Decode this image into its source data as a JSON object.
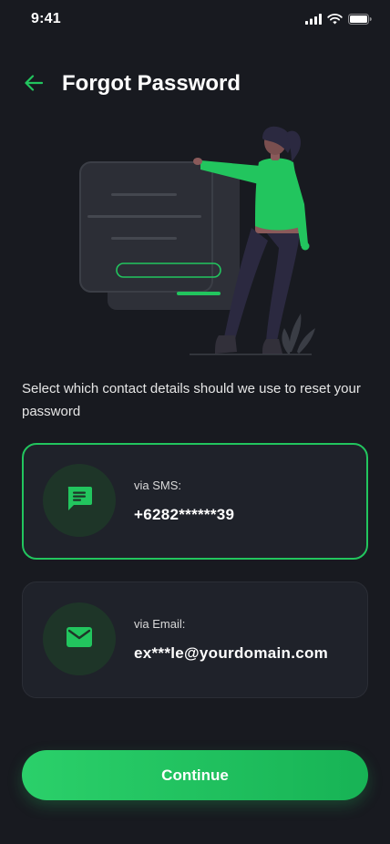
{
  "status_bar": {
    "time": "9:41"
  },
  "header": {
    "title": "Forgot Password"
  },
  "instruction": "Select which contact details should we use to reset your password",
  "options": [
    {
      "label": "via SMS:",
      "value": "+6282******39",
      "icon": "chat-message-icon",
      "selected": true
    },
    {
      "label": "via Email:",
      "value": "ex***le@yourdomain.com",
      "icon": "mail-icon",
      "selected": false
    }
  ],
  "continue_label": "Continue",
  "colors": {
    "accent": "#22c55e",
    "background": "#181a20",
    "card": "#1f222a"
  }
}
